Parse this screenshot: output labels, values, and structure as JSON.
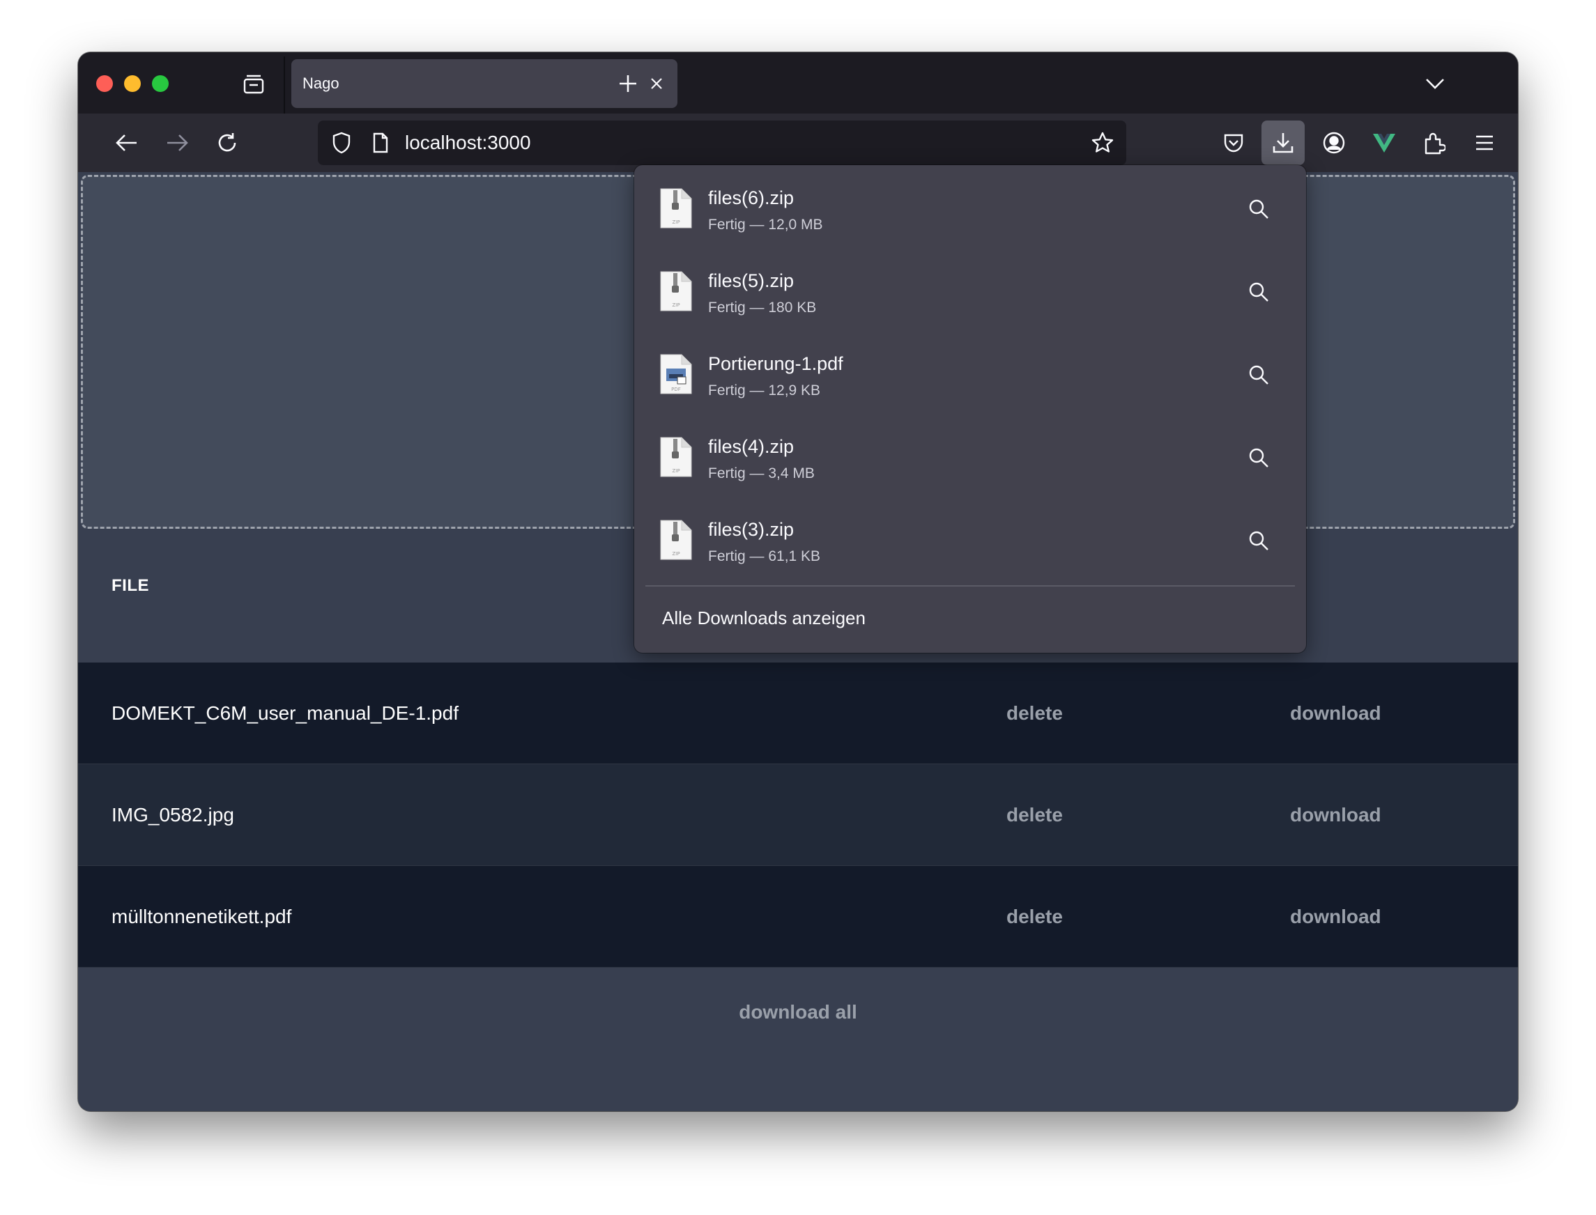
{
  "browser": {
    "tab_title": "Nago",
    "url": "localhost:3000"
  },
  "table": {
    "header": "FILE",
    "rows": [
      {
        "name": "DOMEKT_C6M_user_manual_DE-1.pdf",
        "delete": "delete",
        "download": "download"
      },
      {
        "name": "IMG_0582.jpg",
        "delete": "delete",
        "download": "download"
      },
      {
        "name": "mülltonnenetikett.pdf",
        "delete": "delete",
        "download": "download"
      }
    ],
    "download_all": "download all"
  },
  "downloads_panel": {
    "items": [
      {
        "name": "files(6).zip",
        "status": "Fertig — 12,0 MB",
        "type": "zip"
      },
      {
        "name": "files(5).zip",
        "status": "Fertig — 180 KB",
        "type": "zip"
      },
      {
        "name": "Portierung-1.pdf",
        "status": "Fertig — 12,9 KB",
        "type": "pdf"
      },
      {
        "name": "files(4).zip",
        "status": "Fertig — 3,4 MB",
        "type": "zip"
      },
      {
        "name": "files(3).zip",
        "status": "Fertig — 61,1 KB",
        "type": "zip"
      }
    ],
    "show_all": "Alle Downloads anzeigen"
  },
  "colors": {
    "vue_green": "#41b883",
    "panel_bg": "#42414d",
    "page_bg": "#383f50"
  }
}
